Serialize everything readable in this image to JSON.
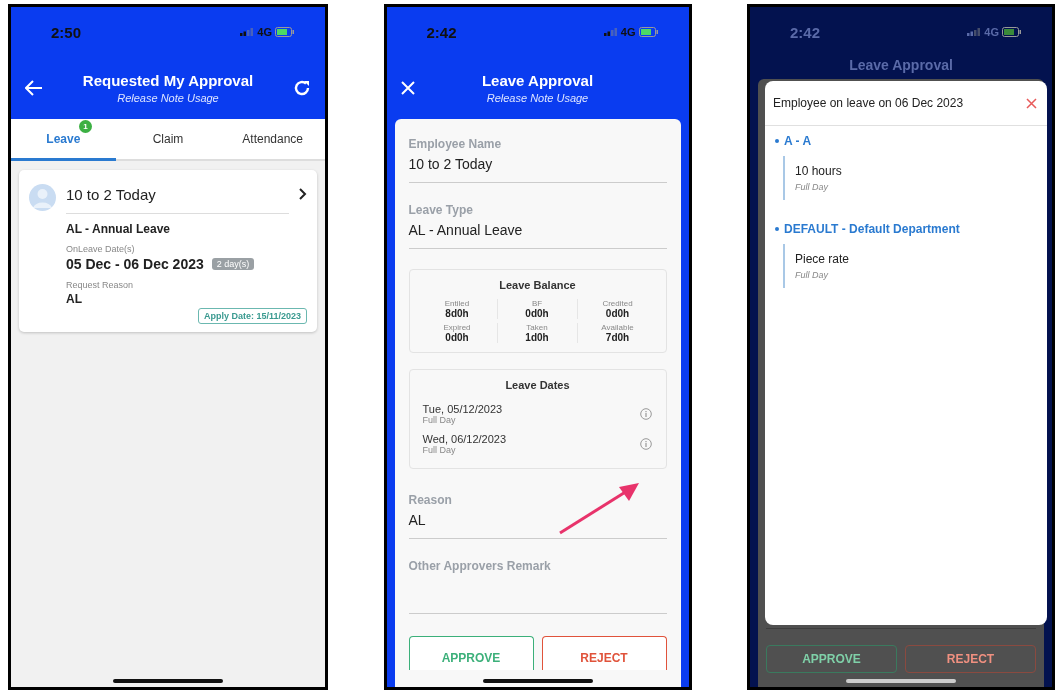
{
  "screens": [
    {
      "kind": "list",
      "status": {
        "time": "2:50",
        "network": "4G"
      },
      "header": {
        "title": "Requested My Approval",
        "subtitle": "Release Note Usage"
      },
      "tabs": [
        {
          "label": "Leave",
          "selected": true,
          "badge": "1"
        },
        {
          "label": "Claim",
          "selected": false
        },
        {
          "label": "Attendance",
          "selected": false
        }
      ],
      "requests": [
        {
          "name": "10 to 2 Today",
          "leave_type": "AL - Annual Leave",
          "dates_label": "OnLeave Date(s)",
          "dates": "05 Dec - 06 Dec 2023",
          "days": "2 day(s)",
          "reason_label": "Request Reason",
          "reason": "AL",
          "apply_date": "Apply Date: 15/11/2023"
        }
      ]
    },
    {
      "kind": "detail",
      "status": {
        "time": "2:42",
        "network": "4G"
      },
      "header": {
        "title": "Leave Approval",
        "subtitle": "Release Note Usage"
      },
      "fields": [
        {
          "label": "Employee Name",
          "value": "10 to 2 Today"
        },
        {
          "label": "Leave Type",
          "value": "AL - Annual Leave"
        }
      ],
      "balance": {
        "title": "Leave Balance",
        "items": [
          {
            "label": "Entiled",
            "value": "8d0h"
          },
          {
            "label": "BF",
            "value": "0d0h"
          },
          {
            "label": "Credited",
            "value": "0d0h"
          },
          {
            "label": "Expired",
            "value": "0d0h"
          },
          {
            "label": "Taken",
            "value": "1d0h"
          },
          {
            "label": "Available",
            "value": "7d0h"
          }
        ]
      },
      "leave_dates": {
        "title": "Leave Dates",
        "dates": [
          {
            "date": "Tue, 05/12/2023",
            "portion": "Full Day"
          },
          {
            "date": "Wed, 06/12/2023",
            "portion": "Full Day"
          }
        ]
      },
      "reason": {
        "label": "Reason",
        "value": "AL"
      },
      "remark": {
        "label": "Other Approvers Remark"
      },
      "buttons": [
        {
          "label": "APPROVE",
          "kind": "approve"
        },
        {
          "label": "REJECT",
          "kind": "reject"
        }
      ]
    },
    {
      "kind": "popup",
      "status": {
        "time": "2:42",
        "network": "4G"
      },
      "header": {
        "title": "Leave Approval"
      },
      "dialog": {
        "title": "Employee on leave on 06 Dec 2023",
        "groups": [
          {
            "name": "A - A",
            "entries": [
              {
                "title": "10 hours",
                "portion": "Full Day"
              }
            ]
          },
          {
            "name": "DEFAULT - Default Department",
            "entries": [
              {
                "title": "Piece rate",
                "portion": "Full Day"
              }
            ]
          }
        ]
      },
      "buttons": [
        {
          "label": "APPROVE",
          "kind": "approve"
        },
        {
          "label": "REJECT",
          "kind": "reject"
        }
      ]
    }
  ]
}
